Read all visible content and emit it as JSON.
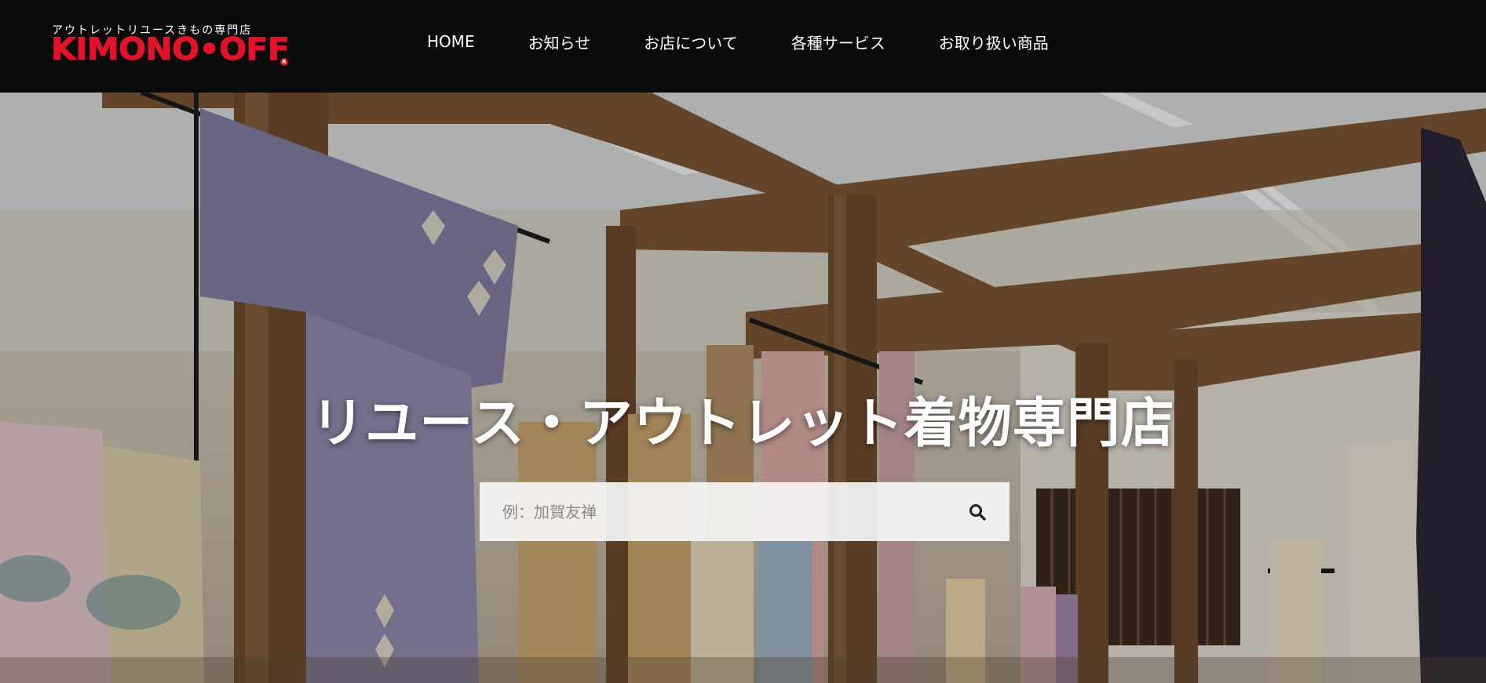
{
  "header": {
    "logo": {
      "tagline": "アウトレットリユースきもの専門店",
      "wordmark": "KIMONO•OFF",
      "brand_color": "#e3122b"
    },
    "nav": [
      {
        "label": "HOME"
      },
      {
        "label": "お知らせ"
      },
      {
        "label": "お店について"
      },
      {
        "label": "各種サービス"
      },
      {
        "label": "お取り扱い商品"
      }
    ]
  },
  "hero": {
    "title": "リユース・アウトレット着物専門店",
    "search": {
      "placeholder": "例：加賀友禅",
      "value": "",
      "icon": "search-icon"
    }
  }
}
